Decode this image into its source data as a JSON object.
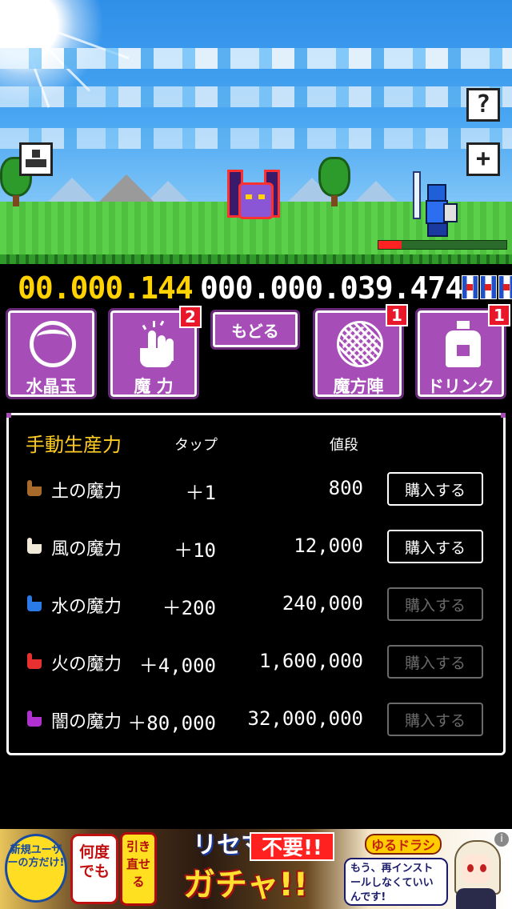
{
  "counter": {
    "power": "00.000.144",
    "coins": "000.000.039.474"
  },
  "menu": {
    "crystal_ball": {
      "label": "水晶玉"
    },
    "magic_power": {
      "label": "魔 力",
      "badge": "2"
    },
    "back": {
      "label": "もどる"
    },
    "magic_circle": {
      "label": "魔方陣",
      "badge": "1"
    },
    "drink": {
      "label": "ドリンク",
      "badge": "1"
    }
  },
  "hero_hp_fraction": 0.18,
  "shop": {
    "title": "手動生産力",
    "col_tap": "タップ",
    "col_price": "値段",
    "items": [
      {
        "name": "土の魔力",
        "tap": "＋1",
        "price": "800",
        "buy": "購入する",
        "enabled": true,
        "hand_color": "#a86a2a"
      },
      {
        "name": "風の魔力",
        "tap": "＋10",
        "price": "12,000",
        "buy": "購入する",
        "enabled": true,
        "hand_color": "#f2ead8"
      },
      {
        "name": "水の魔力",
        "tap": "＋200",
        "price": "240,000",
        "buy": "購入する",
        "enabled": false,
        "hand_color": "#2a7ae8"
      },
      {
        "name": "火の魔力",
        "tap": "＋4,000",
        "price": "1,600,000",
        "buy": "購入する",
        "enabled": false,
        "hand_color": "#e83030"
      },
      {
        "name": "闇の魔力",
        "tap": "＋80,000",
        "price": "32,000,000",
        "buy": "購入する",
        "enabled": false,
        "hand_color": "#b030d0"
      }
    ]
  },
  "ad": {
    "new_user": "新規ユーザーの方だけ!",
    "nando": "何度でも",
    "hikinaoseru": "引き直せる",
    "risemara": "リセマラ",
    "fuyou": "不要!!",
    "gacha": "ガチャ!!",
    "logo": "ゆるドラシル",
    "message": "もう、再インストールしなくていいんです!",
    "info": "i"
  },
  "colors": {
    "accent_purple": "#a64db8",
    "score_yellow": "#ffd200",
    "title_yellow": "#ffcc22",
    "badge_red": "#e8182a"
  },
  "icons": {
    "scene_left": "person-icon",
    "scene_help": "question-icon",
    "scene_add": "plus-icon"
  }
}
